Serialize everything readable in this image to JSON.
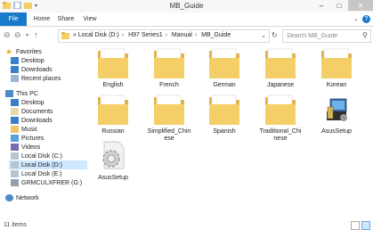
{
  "window": {
    "title": "MB_Guide"
  },
  "ribbon": {
    "tabs": [
      "File",
      "Home",
      "Share",
      "View"
    ]
  },
  "address": {
    "breadcrumbs": [
      "Local Disk (D:)",
      "H97 Series1",
      "Manual",
      "MB_Guide"
    ],
    "overflow": "«",
    "separator": "›"
  },
  "search": {
    "placeholder": "Search MB_Guide"
  },
  "nav_pane": {
    "favorites": {
      "label": "Favorites",
      "items": [
        "Desktop",
        "Downloads",
        "Recent places"
      ]
    },
    "this_pc": {
      "label": "This PC",
      "items": [
        "Desktop",
        "Documents",
        "Downloads",
        "Music",
        "Pictures",
        "Videos",
        "Local Disk (C:)",
        "Local Disk (D:)",
        "Local Disk (E:)",
        "GRMCULXFRER (G:)"
      ],
      "selected_index": 7
    },
    "network": {
      "label": "Network"
    }
  },
  "items": [
    {
      "name": "English",
      "type": "folder"
    },
    {
      "name": "French",
      "type": "folder"
    },
    {
      "name": "German",
      "type": "folder"
    },
    {
      "name": "Japanese",
      "type": "folder"
    },
    {
      "name": "Korean",
      "type": "folder"
    },
    {
      "name": "Russian",
      "type": "folder"
    },
    {
      "name": "Simplified_Chinese",
      "type": "folder"
    },
    {
      "name": "Spanish",
      "type": "folder"
    },
    {
      "name": "Traditional_Chinese",
      "type": "folder"
    },
    {
      "name": "AsusSetup",
      "type": "application"
    },
    {
      "name": "AsusSetup",
      "type": "config"
    }
  ],
  "status": {
    "count_text": "11 items"
  },
  "colors": {
    "folder": "#f4cf68",
    "folder_dark": "#e2b446",
    "accent": "#1979ca",
    "selection": "#cde8ff"
  }
}
